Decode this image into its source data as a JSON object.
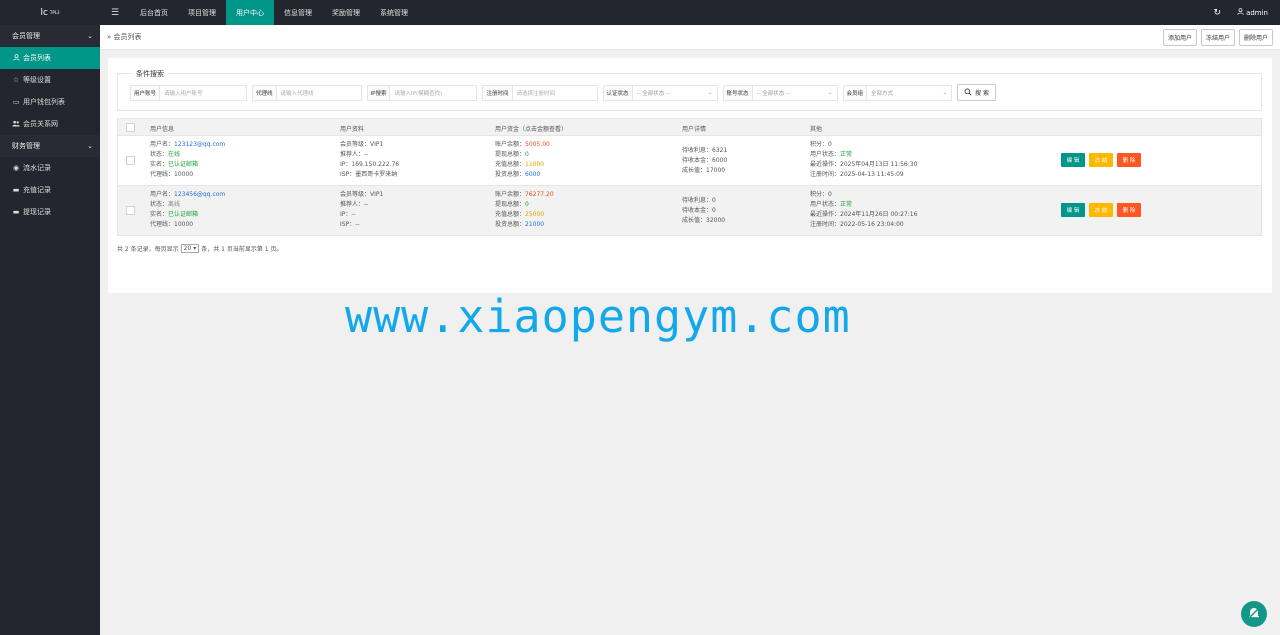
{
  "app": {
    "logo": "lc",
    "version": "TPL3"
  },
  "topnav": {
    "items": [
      {
        "label": "后台首页"
      },
      {
        "label": "项目管理"
      },
      {
        "label": "用户中心"
      },
      {
        "label": "信息管理"
      },
      {
        "label": "奖励管理"
      },
      {
        "label": "系统管理"
      }
    ],
    "active_index": 2,
    "user": "admin"
  },
  "sidebar": {
    "groups": [
      {
        "label": "会员管理",
        "items": [
          {
            "label": "会员列表",
            "icon": "user-icon",
            "active": true
          },
          {
            "label": "等级设置",
            "icon": "star-icon"
          },
          {
            "label": "用户钱包列表",
            "icon": "card-icon"
          },
          {
            "label": "会员关系网",
            "icon": "users-icon"
          }
        ]
      },
      {
        "label": "财务管理",
        "items": [
          {
            "label": "流水记录",
            "icon": "circle-icon"
          },
          {
            "label": "充值记录",
            "icon": "card-icon"
          },
          {
            "label": "提现记录",
            "icon": "card-icon"
          }
        ]
      }
    ]
  },
  "breadcrumb": "» 会员列表",
  "actions": {
    "add": "添加用户",
    "freeze": "冻结用户",
    "delete": "删除用户"
  },
  "search": {
    "legend": "条件搜索",
    "account_label": "用户账号",
    "account_placeholder": "请输入用户账号",
    "agent_label": "代理线",
    "agent_placeholder": "请输入代理线",
    "ip_label": "IP搜索",
    "ip_placeholder": "请输入IP(模糊查找)",
    "regtime_label": "注册时间",
    "regtime_placeholder": "请选择注册时间",
    "verify_label": "认证状态",
    "verify_value": "-- 全部状态 --",
    "status_label": "账号状态",
    "status_value": "-- 全部状态 --",
    "group_label": "会员组",
    "group_value": "全部方式",
    "button": "搜 索"
  },
  "table": {
    "headers": [
      "用户信息",
      "用户资料",
      "用户资金（点击金额查看）",
      "用户详情",
      "其他"
    ],
    "rows": [
      {
        "username_label": "用户名：",
        "username": "123123@qq.com",
        "state_label": "状态：",
        "state": "在线",
        "realname_label": "实名：",
        "realname": "已认证邮箱",
        "agent_label": "代理线：",
        "agent": "10000",
        "level_label": "会员等级：",
        "level": "VIP1",
        "referrer_label": "推荐人：",
        "referrer": "--",
        "ip_label": "IP：",
        "ip": "169.150.222.76",
        "isp_label": "ISP：",
        "isp": "墨西哥卡罗来纳",
        "balance_label": "账户余额：",
        "balance": "5005.00",
        "withdraw_label": "提现总额：",
        "withdraw": "0",
        "recharge_label": "充值总额：",
        "recharge": "11000",
        "invest_label": "投资总额：",
        "invest": "6000",
        "pending_interest_label": "待收利息：",
        "pending_interest": "6321",
        "pending_principal_label": "待收本金：",
        "pending_principal": "6000",
        "growth_label": "成长值：",
        "growth": "17000",
        "points_label": "积分：",
        "points": "0",
        "user_status_label": "用户状态：",
        "user_status": "正常",
        "last_op_label": "最近操作：",
        "last_op": "2025年04月13日 11:56:30",
        "reg_label": "注册时间：",
        "reg": "2025-04-13 11:45:09"
      },
      {
        "username_label": "用户名：",
        "username": "123456@qq.com",
        "state_label": "状态：",
        "state": "离线",
        "realname_label": "实名：",
        "realname": "已认证邮箱",
        "agent_label": "代理线：",
        "agent": "10000",
        "level_label": "会员等级：",
        "level": "VIP1",
        "referrer_label": "推荐人：",
        "referrer": "--",
        "ip_label": "IP：",
        "ip": "--",
        "isp_label": "ISP：",
        "isp": "--",
        "balance_label": "账户余额：",
        "balance": "76277.20",
        "withdraw_label": "提现总额：",
        "withdraw": "0",
        "recharge_label": "充值总额：",
        "recharge": "25000",
        "invest_label": "投资总额：",
        "invest": "21000",
        "pending_interest_label": "待收利息：",
        "pending_interest": "0",
        "pending_principal_label": "待收本金：",
        "pending_principal": "0",
        "growth_label": "成长值：",
        "growth": "32000",
        "points_label": "积分：",
        "points": "0",
        "user_status_label": "用户状态：",
        "user_status": "正常",
        "last_op_label": "最近操作：",
        "last_op": "2024年11月26日 00:27:16",
        "reg_label": "注册时间：",
        "reg": "2022-05-16 23:04:00"
      }
    ],
    "ops": {
      "edit": "编 辑",
      "freeze": "冻 结",
      "delete": "删 除"
    }
  },
  "pager": {
    "prefix": "共 2 条记录，每页显示",
    "page_size": "20",
    "suffix": "条，共 1 页当前显示第 1 页。"
  },
  "watermark": "www.xiaopengym.com",
  "colors": {
    "accent": "#009688",
    "topbar": "#23262e",
    "warning": "#ffb800",
    "danger": "#ff5722"
  }
}
